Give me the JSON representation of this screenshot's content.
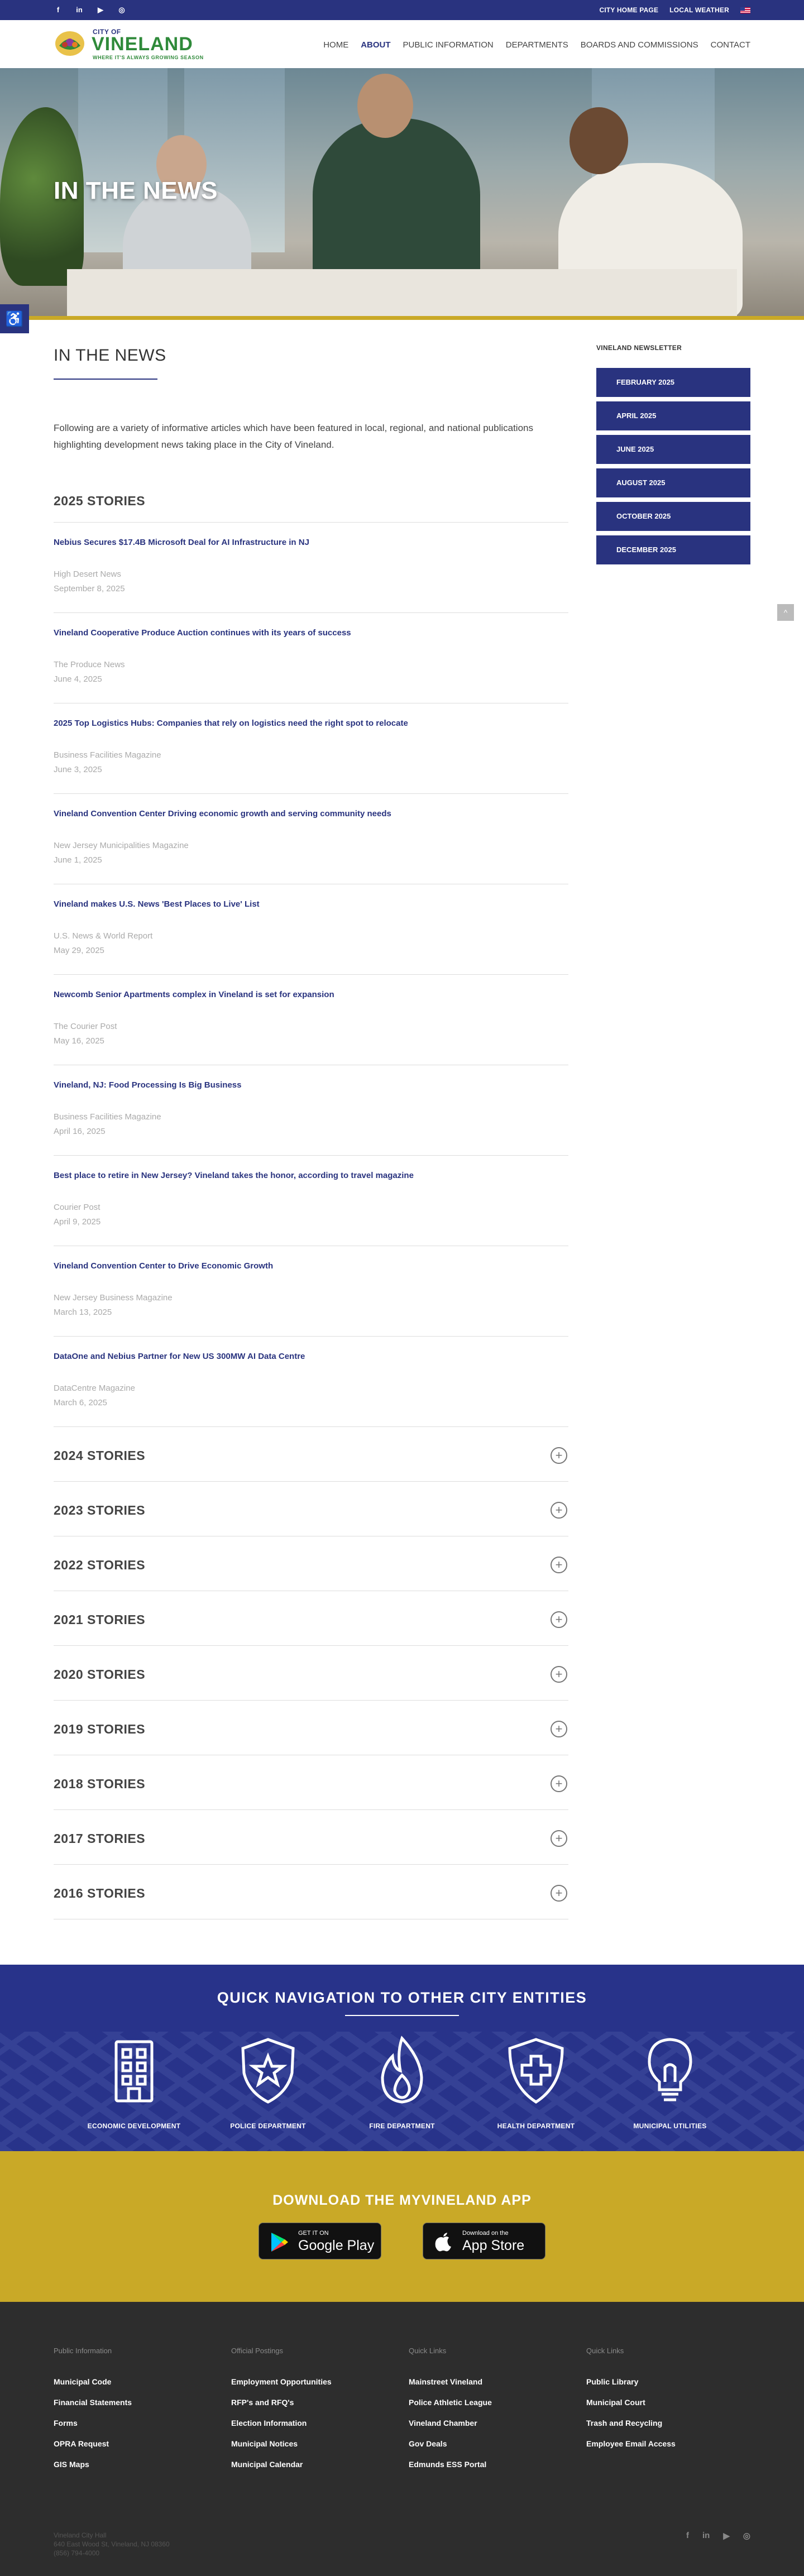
{
  "topbar": {
    "social_icons": [
      "facebook-icon",
      "linkedin-icon",
      "youtube-icon",
      "instagram-icon"
    ],
    "social_glyphs": [
      "f",
      "in",
      "▶",
      "◎"
    ],
    "links": [
      "CITY HOME PAGE",
      "LOCAL WEATHER"
    ]
  },
  "header": {
    "logo": {
      "city_of": "CITY OF",
      "name": "VINELAND",
      "tagline": "WHERE IT'S ALWAYS GROWING SEASON"
    },
    "nav": [
      "HOME",
      "ABOUT",
      "PUBLIC INFORMATION",
      "DEPARTMENTS",
      "BOARDS AND COMMISSIONS",
      "CONTACT"
    ],
    "active_nav": "ABOUT"
  },
  "hero": {
    "title": "IN THE NEWS"
  },
  "accessibility": {
    "icon": "accessibility-icon",
    "glyph": "♿"
  },
  "main": {
    "title": "IN THE NEWS",
    "intro": "Following are a variety of informative articles which have been featured in local, regional, and national publications highlighting development news taking place in the City of Vineland.",
    "year_title": "2025 STORIES",
    "stories": [
      {
        "headline": "Nebius Secures $17.4B Microsoft Deal for AI Infrastructure in NJ",
        "source": "High Desert News",
        "date": "September 8, 2025"
      },
      {
        "headline": "Vineland Cooperative Produce Auction continues with its years of success",
        "source": "The Produce News",
        "date": "June 4, 2025"
      },
      {
        "headline": "2025 Top Logistics Hubs: Companies that rely on logistics need the right spot to relocate",
        "source": "Business Facilities Magazine",
        "date": "June 3, 2025"
      },
      {
        "headline": "Vineland Convention Center Driving economic growth and serving community needs",
        "source": "New Jersey Municipalities Magazine",
        "date": "June 1, 2025"
      },
      {
        "headline": "Vineland makes U.S. News 'Best Places to Live' List",
        "source": "U.S. News & World Report",
        "date": "May 29, 2025"
      },
      {
        "headline": "Newcomb Senior Apartments complex in Vineland is set for expansion",
        "source": "The Courier Post",
        "date": "May 16, 2025"
      },
      {
        "headline": "Vineland, NJ: Food Processing Is Big Business",
        "source": "Business Facilities Magazine",
        "date": "April 16, 2025"
      },
      {
        "headline": "Best place to retire in New Jersey? Vineland takes the honor, according to travel magazine",
        "source": "Courier Post",
        "date": "April 9, 2025"
      },
      {
        "headline": "Vineland Convention Center to Drive Economic Growth",
        "source": "New Jersey Business Magazine",
        "date": "March 13, 2025"
      },
      {
        "headline": "DataOne and Nebius Partner for New US 300MW AI Data Centre",
        "source": "DataCentre Magazine",
        "date": "March 6, 2025"
      }
    ],
    "accordions": [
      "2024 STORIES",
      "2023 STORIES",
      "2022 STORIES",
      "2021 STORIES",
      "2020 STORIES",
      "2019 STORIES",
      "2018 STORIES",
      "2017 STORIES",
      "2016 STORIES"
    ],
    "accordion_glyph": "+"
  },
  "sidebar": {
    "title": "VINELAND NEWSLETTER",
    "buttons": [
      "FEBRUARY 2025",
      "APRIL 2025",
      "JUNE 2025",
      "AUGUST 2025",
      "OCTOBER 2025",
      "DECEMBER 2025"
    ],
    "scroll_glyph": "^"
  },
  "quicknav": {
    "title": "QUICK NAVIGATION TO OTHER CITY ENTITIES",
    "items": [
      {
        "label": "ECONOMIC DEVELOPMENT",
        "icon": "building-icon"
      },
      {
        "label": "POLICE DEPARTMENT",
        "icon": "police-badge-icon"
      },
      {
        "label": "FIRE DEPARTMENT",
        "icon": "flame-icon"
      },
      {
        "label": "HEALTH DEPARTMENT",
        "icon": "health-shield-icon"
      },
      {
        "label": "MUNICIPAL UTILITIES",
        "icon": "lightbulb-icon"
      }
    ]
  },
  "app": {
    "title": "DOWNLOAD THE MYVINELAND APP",
    "google": {
      "small": "GET IT ON",
      "big": "Google Play",
      "icon": "google-play-icon"
    },
    "apple": {
      "small": "Download on the",
      "big": "App Store",
      "icon": "apple-icon"
    }
  },
  "footer": {
    "columns": [
      {
        "head": "Public Information",
        "links": [
          "Municipal Code",
          "Financial Statements",
          "Forms",
          "OPRA Request",
          "GIS Maps"
        ]
      },
      {
        "head": "Official Postings",
        "links": [
          "Employment Opportunities",
          "RFP's and RFQ's",
          "Election Information",
          "Municipal Notices",
          "Municipal Calendar"
        ]
      },
      {
        "head": "Quick Links",
        "links": [
          "Mainstreet Vineland",
          "Police Athletic League",
          "Vineland Chamber",
          "Gov Deals",
          "Edmunds ESS Portal"
        ]
      },
      {
        "head": "Quick Links",
        "links": [
          "Public Library",
          "Municipal Court",
          "Trash and Recycling",
          "Employee Email Access"
        ]
      }
    ],
    "address": [
      "Vineland City Hall",
      "640 East Wood St, Vineland, NJ 08360",
      "(856) 794-4000"
    ],
    "social_icons": [
      "facebook-icon",
      "linkedin-icon",
      "youtube-icon",
      "instagram-icon"
    ],
    "social_glyphs": [
      "f",
      "in",
      "▶",
      "◎"
    ]
  },
  "colors": {
    "primary": "#29337f",
    "gold": "#c9a927",
    "footer": "#2d2d2d",
    "logo_green": "#2f8a3a"
  }
}
